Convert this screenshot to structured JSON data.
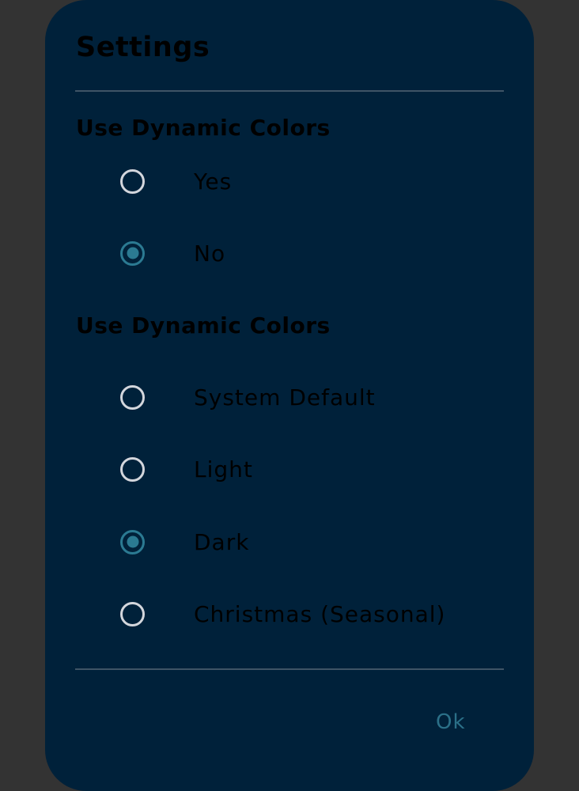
{
  "dialog": {
    "title": "Settings",
    "ok_label": "Ok"
  },
  "sections": [
    {
      "header": "Use Dynamic Colors",
      "options": [
        {
          "label": "Yes",
          "selected": false
        },
        {
          "label": "No",
          "selected": true
        }
      ]
    },
    {
      "header": "Use Dynamic Colors",
      "options": [
        {
          "label": "System Default",
          "selected": false
        },
        {
          "label": "Light",
          "selected": false
        },
        {
          "label": "Dark",
          "selected": true
        },
        {
          "label": "Christmas (Seasonal)",
          "selected": false
        }
      ]
    }
  ],
  "colors": {
    "scrim": "#333333",
    "dialog_background": "#00213a",
    "accent": "#2b7a92",
    "radio_unselected": "#d3d6dc",
    "divider": "#3f5466"
  }
}
